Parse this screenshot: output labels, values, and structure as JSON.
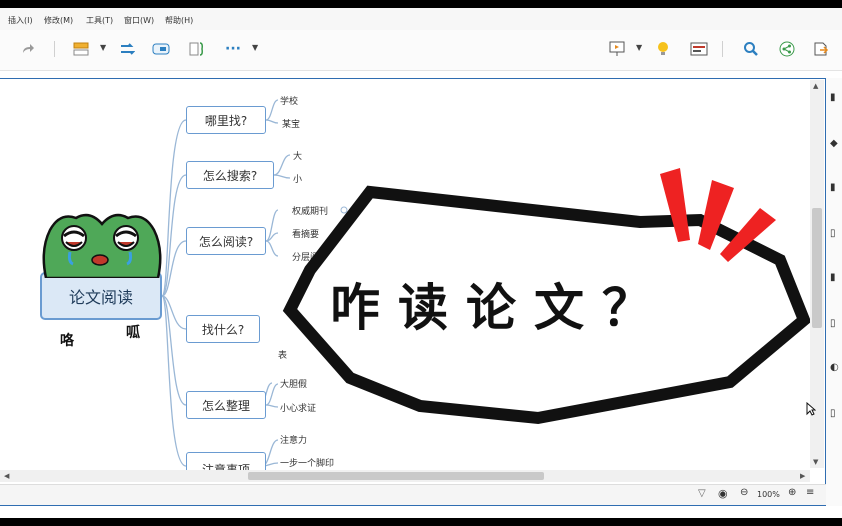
{
  "menu": {
    "items": [
      "插入(I)",
      "修改(M)",
      "工具(T)",
      "窗口(W)",
      "帮助(H)"
    ]
  },
  "icons": {
    "redo": "redo-icon",
    "insert_topic": "insert-topic-icon",
    "relationship": "relationship-icon",
    "boundary": "boundary-icon",
    "summary": "summary-icon",
    "more": "more-icon",
    "presentation": "presentation-icon",
    "idea": "lightbulb-icon",
    "outline": "outline-icon",
    "search": "search-icon",
    "share": "share-icon",
    "export": "export-icon"
  },
  "mindmap": {
    "central": "论文阅读",
    "branches": [
      {
        "label": "哪里找?",
        "children": [
          "学校",
          "某宝"
        ]
      },
      {
        "label": "怎么搜索?",
        "children": [
          "大",
          "小"
        ]
      },
      {
        "label": "怎么阅读?",
        "children": [
          "权威期刊",
          "看摘要",
          "分层阅"
        ]
      },
      {
        "label": "找什么?",
        "children": [
          "表"
        ]
      },
      {
        "label": "怎么整理",
        "children": [
          "大胆假",
          "小心求证"
        ]
      },
      {
        "label": "注意事项",
        "children": [
          "注意力",
          "一步一个脚印"
        ]
      }
    ]
  },
  "overlay": {
    "bubble_text": "咋读论文？",
    "frog_left": "咯",
    "frog_right": "呱"
  },
  "status": {
    "zoom": "100%"
  },
  "colors": {
    "accent": "#6a9bd1",
    "frame": "#2f6db1",
    "red_marks": "#ee2222",
    "frog_green": "#4fa858"
  }
}
